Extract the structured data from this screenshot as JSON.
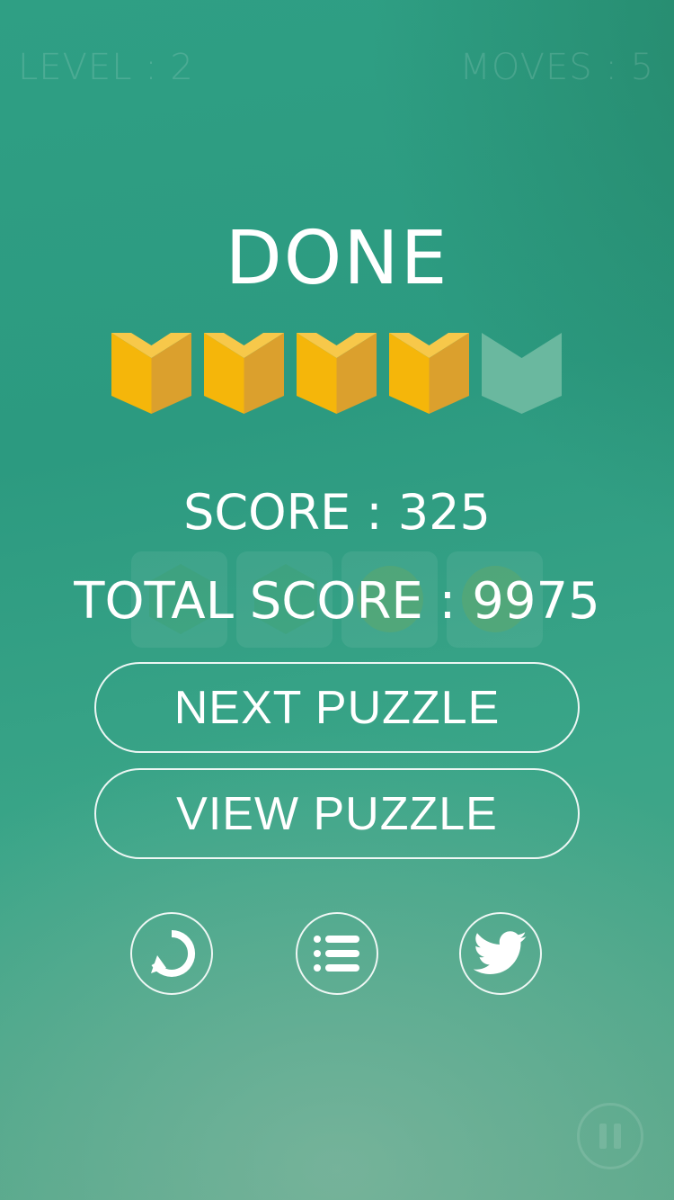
{
  "hud": {
    "level": "LEVEL : 2",
    "moves": "MOVES : 5"
  },
  "result": {
    "title": "DONE",
    "rating": {
      "earned": 4,
      "max": 5
    },
    "score": "SCORE : 325",
    "total_score": "TOTAL SCORE : 9975"
  },
  "buttons": {
    "next_puzzle": "NEXT PUZZLE",
    "view_puzzle": "VIEW PUZZLE"
  },
  "icons": [
    "retry-icon",
    "level-list-icon",
    "twitter-icon",
    "pause-icon"
  ],
  "colors": {
    "background_top": "#2f9f84",
    "background_bottom": "#52a586",
    "star_gold_light": "#f7c84a",
    "star_gold_front": "#f5b60a",
    "star_gold_side": "#dba02d",
    "star_empty": "#6ab89f"
  }
}
